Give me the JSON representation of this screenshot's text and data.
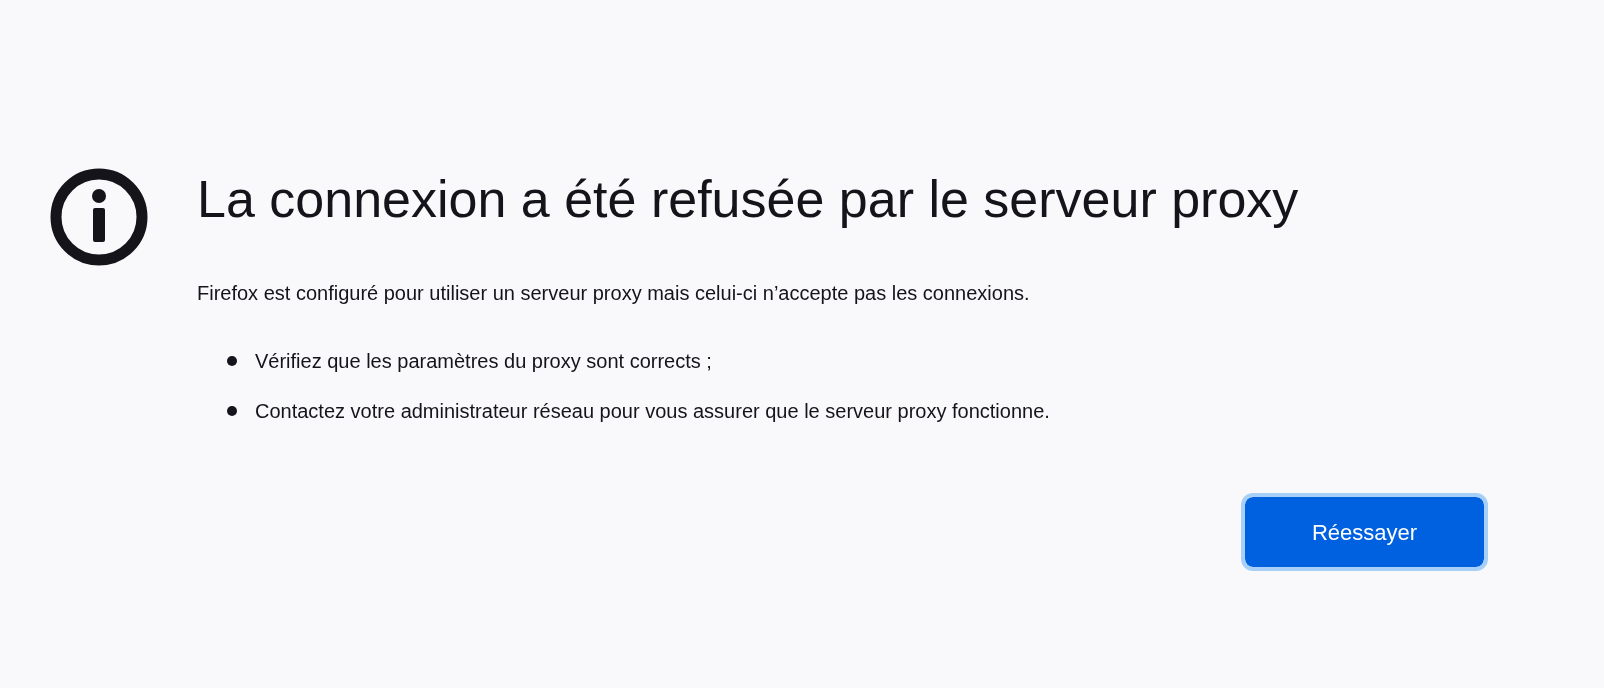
{
  "title": "La connexion a été refusée par le serveur proxy",
  "description": "Firefox est configuré pour utiliser un serveur proxy mais celui-ci n’accepte pas les connexions.",
  "suggestions": [
    "Vérifiez que les paramètres du proxy sont corrects ;",
    "Contactez votre administrateur réseau pour vous assurer que le serveur proxy fonctionne."
  ],
  "button": {
    "label": "Réessayer",
    "focused": true
  }
}
